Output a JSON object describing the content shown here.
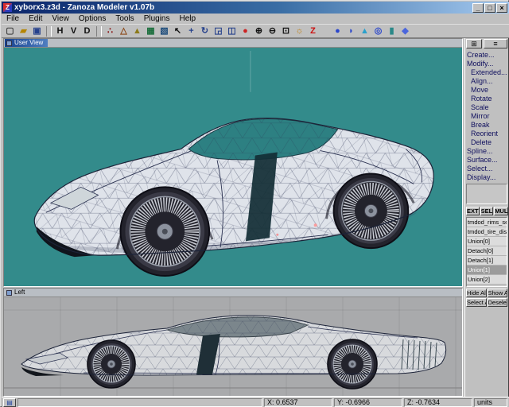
{
  "window": {
    "title": "xyborx3.z3d - Zanoza Modeler v1.07b",
    "icon_letter": "Z",
    "minimize": "_",
    "maximize": "□",
    "close": "×"
  },
  "menu": {
    "items": [
      "File",
      "Edit",
      "View",
      "Options",
      "Tools",
      "Plugins",
      "Help"
    ]
  },
  "toolbar": {
    "icons": [
      {
        "name": "new-file-icon",
        "glyph": "▢",
        "color": "#404040"
      },
      {
        "name": "open-folder-icon",
        "glyph": "▰",
        "color": "#b58500"
      },
      {
        "name": "save-icon",
        "glyph": "▣",
        "color": "#26418c"
      },
      {
        "name": "toggle-h-icon",
        "glyph": "H",
        "color": "#101010"
      },
      {
        "name": "toggle-v-icon",
        "glyph": "V",
        "color": "#101010"
      },
      {
        "name": "toggle-d-icon",
        "glyph": "D",
        "color": "#101010"
      },
      {
        "name": "vertices-mode-icon",
        "glyph": "∴",
        "color": "#8c1a1a"
      },
      {
        "name": "edges-mode-icon",
        "glyph": "△",
        "color": "#8c4a1a"
      },
      {
        "name": "faces-mode-icon",
        "glyph": "▲",
        "color": "#8c7a1a"
      },
      {
        "name": "mesh-mode-icon",
        "glyph": "▦",
        "color": "#1a6e3c"
      },
      {
        "name": "uv-mode-icon",
        "glyph": "▧",
        "color": "#1a4a7a"
      },
      {
        "name": "select-arrow-icon",
        "glyph": "↖",
        "color": "#101010"
      },
      {
        "name": "move-icon",
        "glyph": "+",
        "color": "#26418c"
      },
      {
        "name": "rotate-icon",
        "glyph": "↻",
        "color": "#26418c"
      },
      {
        "name": "scale-icon",
        "glyph": "◲",
        "color": "#26418c"
      },
      {
        "name": "mirror-icon",
        "glyph": "◫",
        "color": "#26418c"
      },
      {
        "name": "delete-sphere-icon",
        "glyph": "●",
        "color": "#cc2222"
      },
      {
        "name": "zoom-in-icon",
        "glyph": "⊕",
        "color": "#101010"
      },
      {
        "name": "zoom-out-icon",
        "glyph": "⊖",
        "color": "#101010"
      },
      {
        "name": "zoom-extents-icon",
        "glyph": "⊡",
        "color": "#101010"
      },
      {
        "name": "light-icon",
        "glyph": "☼",
        "color": "#c07a00"
      },
      {
        "name": "z-plugin-icon",
        "glyph": "Z",
        "color": "#cc1111"
      },
      {
        "name": "create-sphere-icon",
        "glyph": "●",
        "color": "#2a46cc"
      },
      {
        "name": "create-hemisphere-icon",
        "glyph": "◗",
        "color": "#2a46cc"
      },
      {
        "name": "create-cone-icon",
        "glyph": "▲",
        "color": "#2aa0cc"
      },
      {
        "name": "create-torus-icon",
        "glyph": "◎",
        "color": "#2a46cc"
      },
      {
        "name": "create-cylinder-icon",
        "glyph": "▮",
        "color": "#2a8888"
      },
      {
        "name": "create-prism-icon",
        "glyph": "◆",
        "color": "#4a66dd"
      }
    ]
  },
  "viewports": {
    "user": {
      "label": "User View"
    },
    "left": {
      "label": "Left"
    }
  },
  "right_panel": {
    "top_buttons": [
      {
        "name": "panel-grid-button",
        "glyph": "⊞"
      },
      {
        "name": "panel-menu-button",
        "glyph": "≡"
      }
    ],
    "commands": [
      "Create...",
      "Modify...",
      "Extended...",
      "Align...",
      "Move",
      "Rotate",
      "Scale",
      "Mirror",
      "Break",
      "Reorient",
      "Delete",
      "Spline...",
      "Surface...",
      "Select...",
      "Display..."
    ],
    "mode_buttons": [
      "EXT",
      "SEL",
      "MUL"
    ],
    "list": {
      "items": [
        "tmdod_rims_set",
        "tmdod_tire_disc_set",
        "Union[0]",
        "Detach[0]",
        "Detach[1]",
        "Union[1]",
        "Union[2]"
      ],
      "selected_index": 5
    },
    "visibility_buttons": [
      "Hide All",
      "Show All"
    ],
    "selection_buttons": [
      "Select All",
      "Deselect"
    ]
  },
  "status_bar": {
    "x": "X: 0.6537",
    "y": "Y: -0.6966",
    "z": "Z: -0.7634",
    "units": "units",
    "grid_button_glyph": "▤"
  },
  "colors": {
    "titlebar_accent": "#0a246a",
    "user_view_bg": "#338b8b",
    "left_view_bg": "#a9aaac",
    "selection_highlight": "#9c9c9c"
  }
}
